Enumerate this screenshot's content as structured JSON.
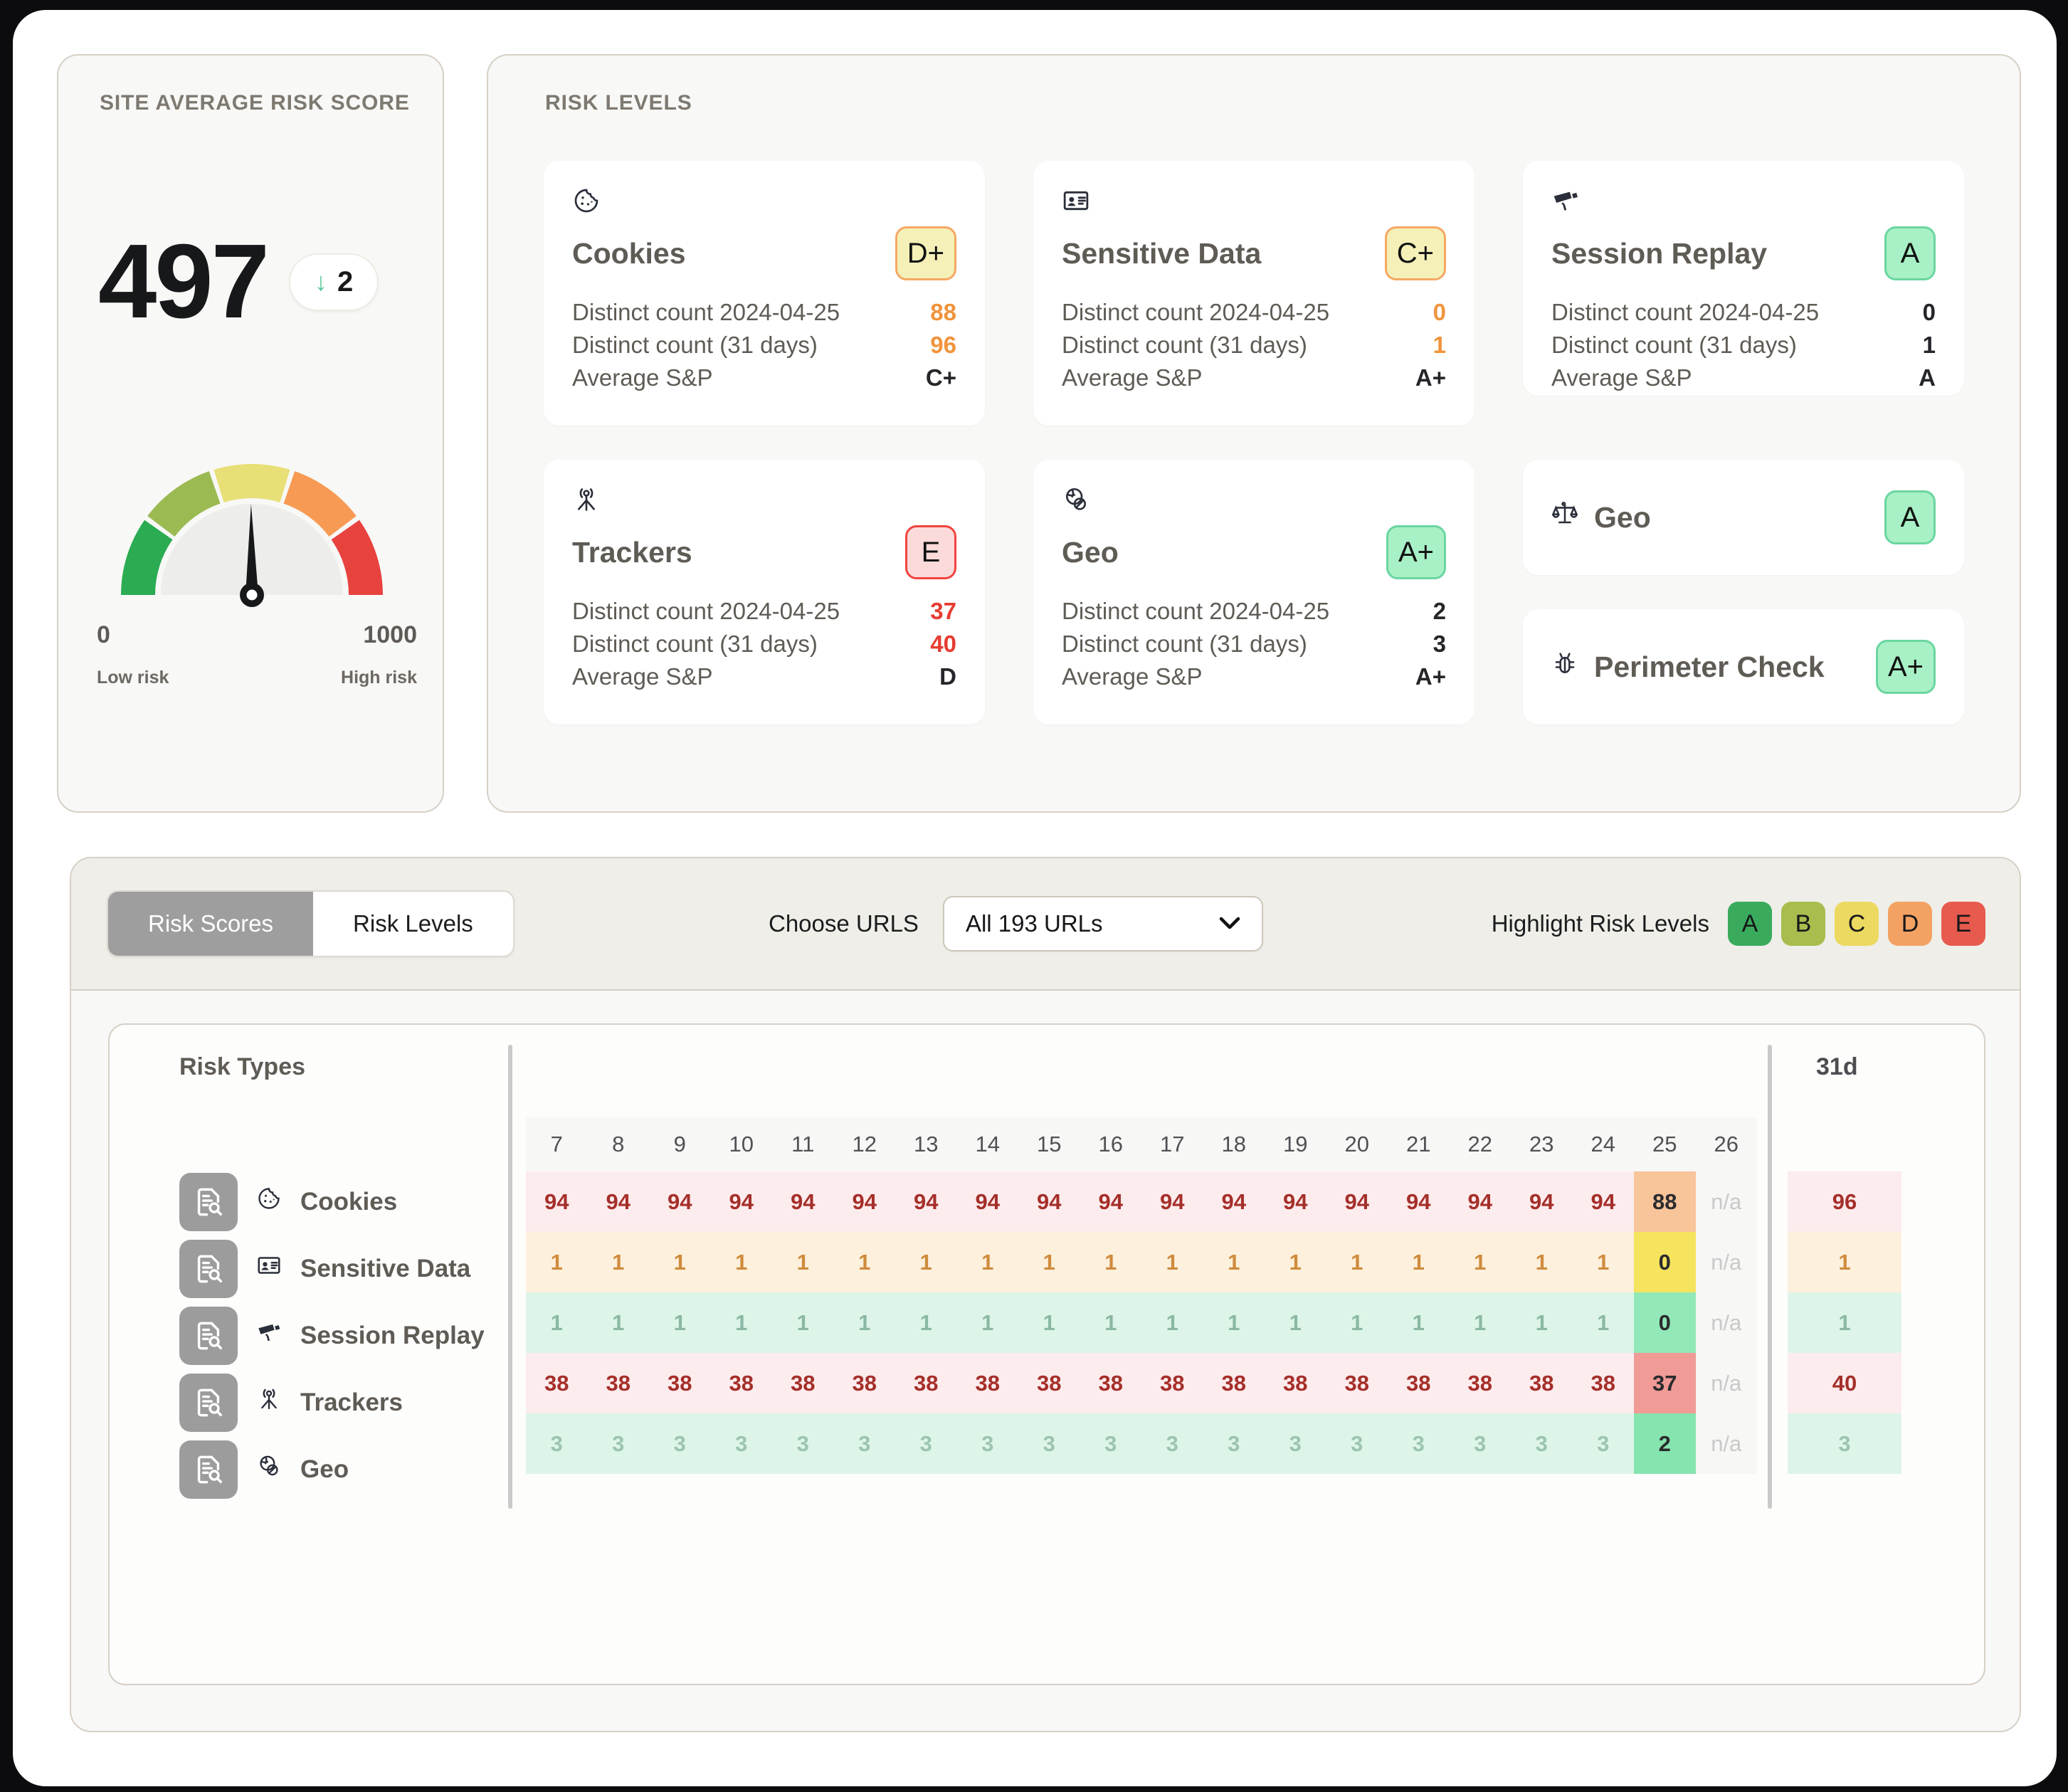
{
  "gauge_panel": {
    "title": "SITE AVERAGE RISK SCORE",
    "score": "497",
    "delta_arrow": "↓",
    "delta_value": "2",
    "min": "0",
    "max": "1000",
    "min_label": "Low risk",
    "max_label": "High risk",
    "needle_value": 497,
    "bands": [
      "#2bab52",
      "#9cba52",
      "#e8df76",
      "#f79a53",
      "#e8423f"
    ]
  },
  "risk_levels_panel": {
    "title": "RISK LEVELS",
    "stat_labels": {
      "distinct_day": "Distinct count 2024-04-25",
      "distinct_31": "Distinct count (31 days)",
      "avg_sp": "Average S&P"
    },
    "cards": [
      {
        "name": "Cookies",
        "icon": "cookie-icon",
        "grade": "D+",
        "grade_tone": "y",
        "distinct_day": "88",
        "distinct_31": "96",
        "avg_sp": "C+",
        "value_tone": "v-orange"
      },
      {
        "name": "Sensitive Data",
        "icon": "id-card-icon",
        "grade": "C+",
        "grade_tone": "y",
        "distinct_day": "0",
        "distinct_31": "1",
        "avg_sp": "A+",
        "value_tone": "v-orange"
      },
      {
        "name": "Session Replay",
        "icon": "cctv-camera-icon",
        "grade": "A",
        "grade_tone": "g",
        "distinct_day": "0",
        "distinct_31": "1",
        "avg_sp": "A",
        "value_tone": "v-dark"
      },
      {
        "name": "Trackers",
        "icon": "tracker-beacon-icon",
        "grade": "E",
        "grade_tone": "r",
        "distinct_day": "37",
        "distinct_31": "40",
        "avg_sp": "D",
        "value_tone": "v-red"
      },
      {
        "name": "Geo",
        "icon": "globe-blocked-icon",
        "grade": "A+",
        "grade_tone": "g",
        "distinct_day": "2",
        "distinct_31": "3",
        "avg_sp": "A+",
        "value_tone": "v-dark"
      }
    ],
    "mini_cards": [
      {
        "name": "Geo",
        "icon": "scales-icon",
        "grade": "A",
        "grade_tone": "g"
      },
      {
        "name": "Perimeter Check",
        "icon": "bug-icon",
        "grade": "A+",
        "grade_tone": "g"
      }
    ]
  },
  "toolbar": {
    "tabs": [
      {
        "label": "Risk Scores",
        "active": true
      },
      {
        "label": "Risk Levels",
        "active": false
      }
    ],
    "choose_urls_label": "Choose URLS",
    "selected_url": "All 193 URLs",
    "chevron": "⌄",
    "highlight_label": "Highlight Risk Levels",
    "highlight_chips": [
      {
        "label": "A",
        "color": "#3aab5c"
      },
      {
        "label": "B",
        "color": "#a8bd4e"
      },
      {
        "label": "C",
        "color": "#ecd961"
      },
      {
        "label": "D",
        "color": "#f3a263"
      },
      {
        "label": "E",
        "color": "#e75a4e"
      }
    ]
  },
  "table": {
    "risk_types_header": "Risk Types",
    "summary_header": "31d",
    "na_text": "n/a",
    "row_icon": "document-search-icon",
    "columns": [
      "7",
      "8",
      "9",
      "10",
      "11",
      "12",
      "13",
      "14",
      "15",
      "16",
      "17",
      "18",
      "19",
      "20",
      "21",
      "22",
      "23",
      "24",
      "25",
      "26"
    ],
    "rows": [
      {
        "name": "Cookies",
        "icon": "cookie-icon",
        "values": [
          "94",
          "94",
          "94",
          "94",
          "94",
          "94",
          "94",
          "94",
          "94",
          "94",
          "94",
          "94",
          "94",
          "94",
          "94",
          "94",
          "94",
          "94",
          "88",
          "n/a"
        ],
        "summary": "96",
        "row_bg": "#fdeced",
        "row_fg": "#a52f2a",
        "hl_bg": "#f8c49a",
        "hl_fg": "#2a2b2e",
        "sum_bg": "#fdeced",
        "sum_fg": "#a52f2a"
      },
      {
        "name": "Sensitive Data",
        "icon": "id-card-icon",
        "values": [
          "1",
          "1",
          "1",
          "1",
          "1",
          "1",
          "1",
          "1",
          "1",
          "1",
          "1",
          "1",
          "1",
          "1",
          "1",
          "1",
          "1",
          "1",
          "0",
          "n/a"
        ],
        "summary": "1",
        "row_bg": "#fdf0dc",
        "row_fg": "#cf8b3c",
        "hl_bg": "#f6e35e",
        "hl_fg": "#2a2b2e",
        "sum_bg": "#fdf0dc",
        "sum_fg": "#cf8b3c"
      },
      {
        "name": "Session Replay",
        "icon": "cctv-camera-icon",
        "values": [
          "1",
          "1",
          "1",
          "1",
          "1",
          "1",
          "1",
          "1",
          "1",
          "1",
          "1",
          "1",
          "1",
          "1",
          "1",
          "1",
          "1",
          "1",
          "0",
          "n/a"
        ],
        "summary": "1",
        "row_bg": "#ddf5e8",
        "row_fg": "#8ab8a4",
        "hl_bg": "#93e8b9",
        "hl_fg": "#2a2b2e",
        "sum_bg": "#ddf5e8",
        "sum_fg": "#8ab8a4"
      },
      {
        "name": "Trackers",
        "icon": "tracker-beacon-icon",
        "values": [
          "38",
          "38",
          "38",
          "38",
          "38",
          "38",
          "38",
          "38",
          "38",
          "38",
          "38",
          "38",
          "38",
          "38",
          "38",
          "38",
          "38",
          "38",
          "37",
          "n/a"
        ],
        "summary": "40",
        "row_bg": "#fdeced",
        "row_fg": "#a52f2a",
        "hl_bg": "#f09b96",
        "hl_fg": "#2a2b2e",
        "sum_bg": "#fdeced",
        "sum_fg": "#a52f2a"
      },
      {
        "name": "Geo",
        "icon": "globe-blocked-icon",
        "values": [
          "3",
          "3",
          "3",
          "3",
          "3",
          "3",
          "3",
          "3",
          "3",
          "3",
          "3",
          "3",
          "3",
          "3",
          "3",
          "3",
          "3",
          "3",
          "2",
          "n/a"
        ],
        "summary": "3",
        "row_bg": "#ddf5e8",
        "row_fg": "#9cc4b1",
        "hl_bg": "#86e4ae",
        "hl_fg": "#2a2b2e",
        "sum_bg": "#ddf5e8",
        "sum_fg": "#9cc4b1"
      }
    ]
  }
}
